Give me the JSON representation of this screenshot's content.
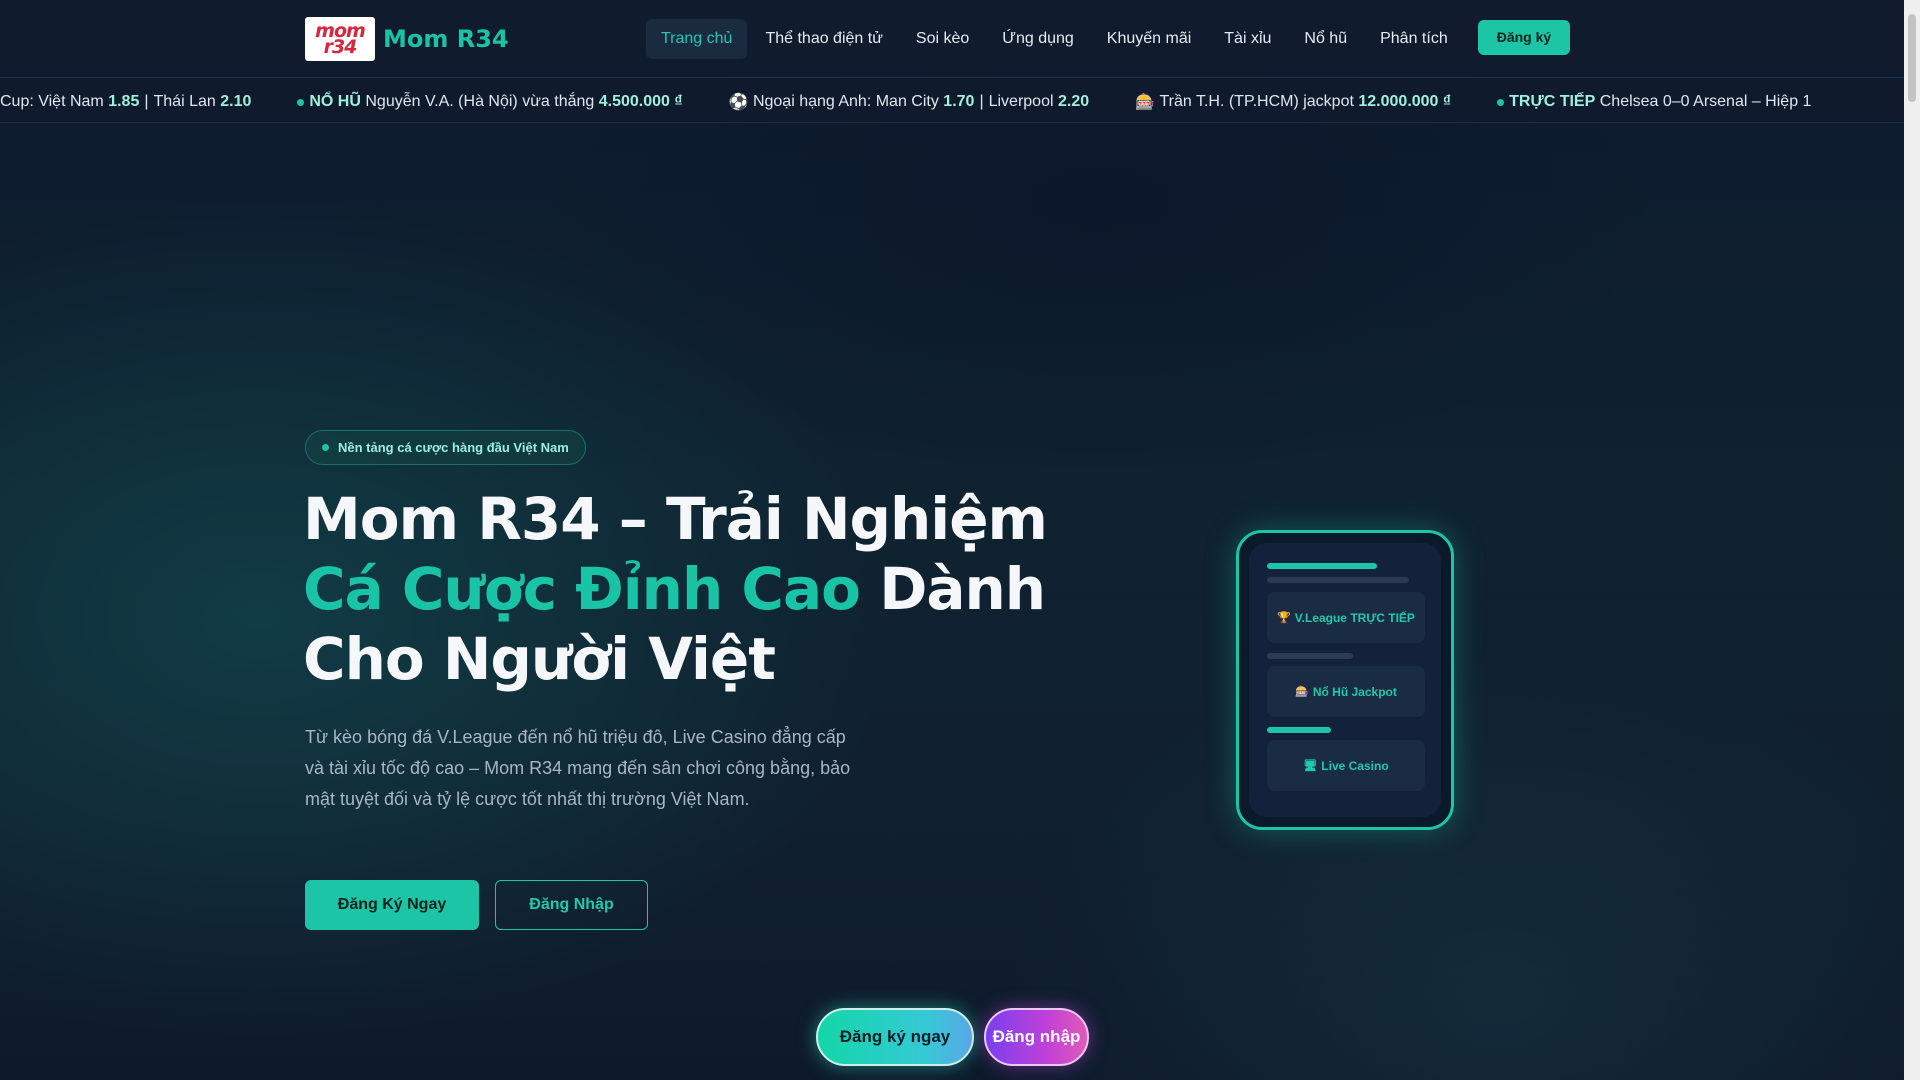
{
  "brand": {
    "logo_text": "mom r34",
    "name": "Mom R34",
    "accent_color": "#1cc5a5"
  },
  "nav": {
    "items": [
      {
        "label": "Trang chủ",
        "active": true
      },
      {
        "label": "Thể thao điện tử",
        "active": false
      },
      {
        "label": "Soi kèo",
        "active": false
      },
      {
        "label": "Ứng dụng",
        "active": false
      },
      {
        "label": "Khuyến mãi",
        "active": false
      },
      {
        "label": "Tài xỉu",
        "active": false
      },
      {
        "label": "Nổ hũ",
        "active": false
      },
      {
        "label": "Phân tích",
        "active": false
      }
    ],
    "register_label": "Đăng ký"
  },
  "ticker": {
    "t1_text": "Cup: Việt Nam",
    "t1_odd1": "1.85",
    "t1_sep": "|",
    "t1_team2": "Thái Lan",
    "t1_odd2": "2.10",
    "t2_tag": "NỔ HŨ",
    "t2_text": "Nguyễn V.A. (Hà Nội) vừa thắng",
    "t2_amount": "4.500.000 ₫",
    "t3_icon": "⚽",
    "t3_text": "Ngoại hạng Anh: Man City",
    "t3_odd1": "1.70",
    "t3_sep": "|",
    "t3_team2": "Liverpool",
    "t3_odd2": "2.20",
    "t4_icon": "🎰",
    "t4_text": "Trần T.H. (TP.HCM) jackpot",
    "t4_amount": "12.000.000 ₫",
    "t5_tag": "TRỰC TIẾP",
    "t5_text": "Chelsea 0–0 Arsenal – Hiệp 1"
  },
  "hero": {
    "badge": "Nền tảng cá cược hàng đầu Việt Nam",
    "title_part1": "Mom R34 – Trải Nghiệm",
    "title_accent": "Cá Cược Đỉnh Cao",
    "title_part2": "Dành Cho Người Việt",
    "description": "Từ kèo bóng đá V.League đến nổ hũ triệu đô, Live Casino đẳng cấp và tài xỉu tốc độ cao – Mom R34 mang đến sân chơi công bằng, bảo mật tuyệt đối và tỷ lệ cược tốt nhất thị trường Việt Nam.",
    "primary_cta": "Đăng Ký Ngay",
    "secondary_cta": "Đăng Nhập"
  },
  "phone": {
    "card1_icon": "🏆",
    "card1_label": "V.League TRỰC TIẾP",
    "card2_icon": "🎰",
    "card2_label": "Nổ Hũ Jackpot",
    "card3_icon": "🖥",
    "card3_label": "Live Casino"
  },
  "floating": {
    "register_label": "Đăng ký ngay",
    "login_label": "Đăng nhập"
  }
}
